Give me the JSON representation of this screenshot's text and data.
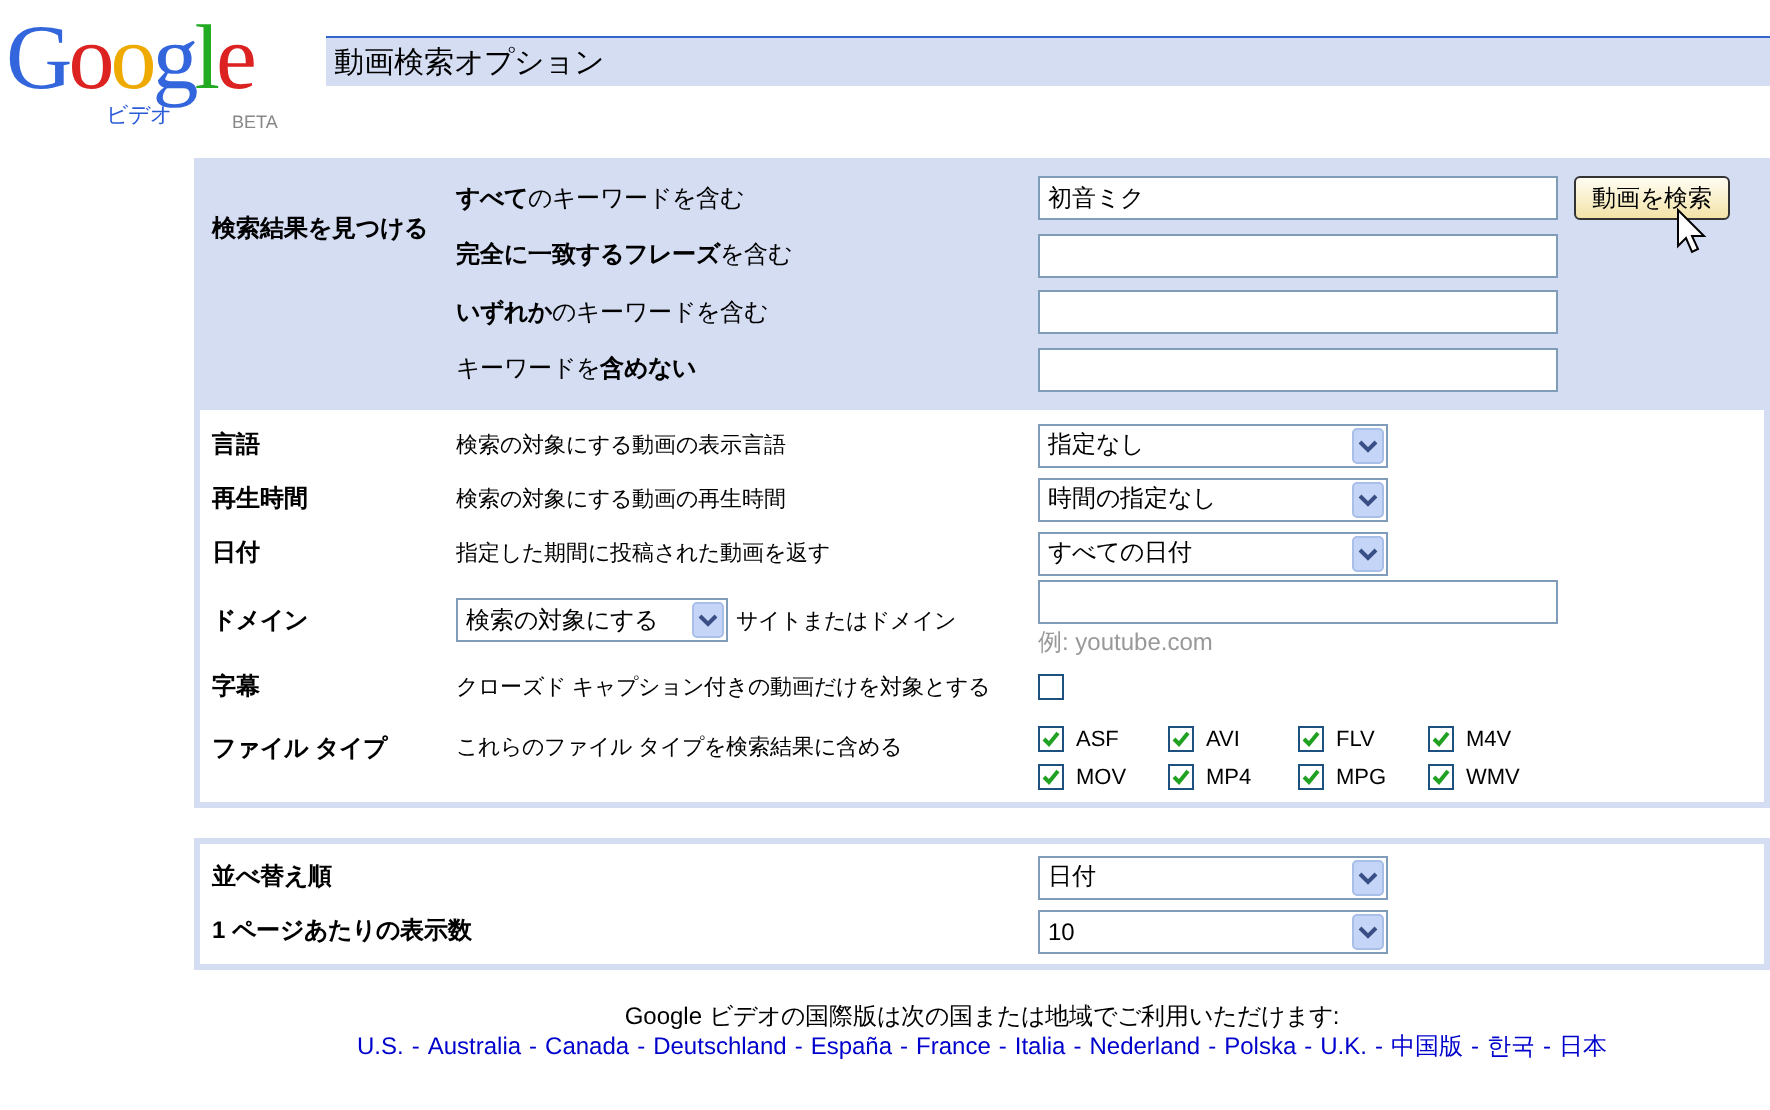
{
  "logo": {
    "text": "Google",
    "sub": "ビデオ",
    "badge": "BETA"
  },
  "header": {
    "title": "動画検索オプション"
  },
  "find": {
    "label": "検索結果を見つける",
    "button": "動画を検索",
    "fields": [
      {
        "label": "**すべて**のキーワードを含む",
        "value": "初音ミク"
      },
      {
        "label": "**完全に一致するフレーズ**を含む"
      },
      {
        "label": "**いずれか**のキーワードを含む"
      },
      {
        "label": "キーワードを**含めない**"
      }
    ]
  },
  "options": [
    {
      "kind": "select",
      "label": "言語",
      "description": "検索の対象にする動画の表示言語",
      "value": "指定なし"
    },
    {
      "kind": "select",
      "label": "再生時間",
      "description": "検索の対象にする動画の再生時間",
      "value": "時間の指定なし"
    },
    {
      "kind": "select",
      "label": "日付",
      "description": "指定した期間に投稿された動画を返す",
      "value": "すべての日付"
    },
    {
      "kind": "domain",
      "label": "ドメイン",
      "select_value": "検索の対象にする",
      "description": "サイトまたはドメイン",
      "hint": "例: youtube.com"
    },
    {
      "kind": "checkbox",
      "label": "字幕",
      "description": "クローズド キャプション付きの動画だけを対象とする",
      "checked": false
    },
    {
      "kind": "filetypes",
      "label": "ファイル タイプ",
      "description": "これらのファイル タイプを検索結果に含める",
      "types": [
        {
          "label": "ASF",
          "checked": true
        },
        {
          "label": "AVI",
          "checked": true
        },
        {
          "label": "FLV",
          "checked": true
        },
        {
          "label": "M4V",
          "checked": true
        },
        {
          "label": "MOV",
          "checked": true
        },
        {
          "label": "MP4",
          "checked": true
        },
        {
          "label": "MPG",
          "checked": true
        },
        {
          "label": "WMV",
          "checked": true
        }
      ]
    }
  ],
  "display": [
    {
      "label": "並べ替え順",
      "value": "日付"
    },
    {
      "label": "1 ページあたりの表示数",
      "value": "10"
    }
  ],
  "footer": {
    "note": "Google ビデオの国際版は次の国または地域でご利用いただけます:",
    "separator": "-",
    "links": [
      "U.S.",
      "Australia",
      "Canada",
      "Deutschland",
      "España",
      "France",
      "Italia",
      "Nederland",
      "Polska",
      "U.K.",
      "中国版",
      "한국",
      "日本"
    ]
  }
}
